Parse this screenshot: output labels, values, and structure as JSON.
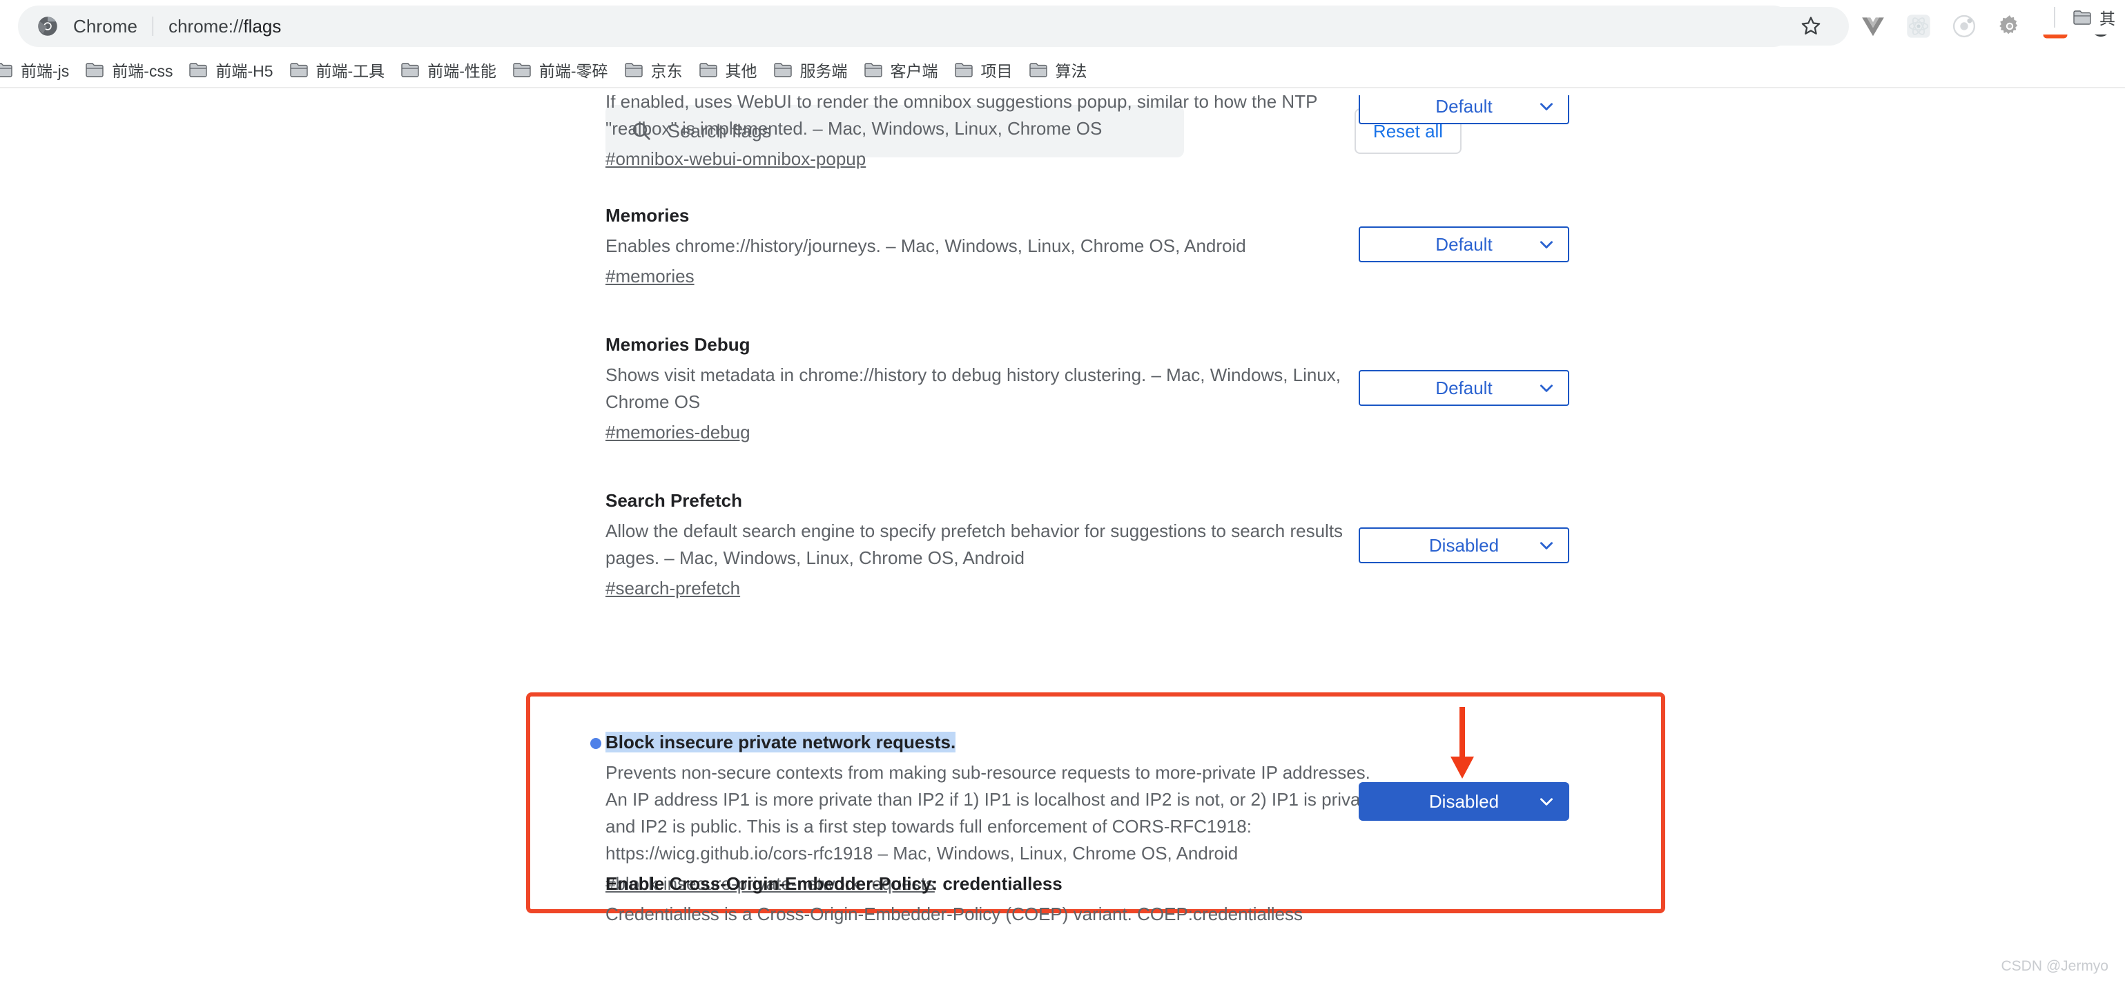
{
  "browser": {
    "omnibox": {
      "app_name": "Chrome",
      "url_prefix": "chrome://",
      "url_suffix": "flags",
      "chrome_logo_icon": "chrome-logo-icon",
      "star_icon": "bookmark-star-icon"
    },
    "extensions": [
      {
        "name": "vue-devtools-icon",
        "color": "#8a8a8a"
      },
      {
        "name": "react-devtools-icon",
        "color": "#d8d8d8"
      },
      {
        "name": "ionic-devtools-icon",
        "color": "#d0d0d0"
      },
      {
        "name": "gear-extension-icon",
        "color": "#9e9e9e"
      },
      {
        "name": "orange-extension-icon",
        "color": "#f4511e"
      },
      {
        "name": "sync-extension-icon",
        "color": "#3c4043"
      },
      {
        "name": "profile-avatar-icon",
        "color": "#9aa0a6"
      }
    ],
    "bookmarks": [
      {
        "label": "前端-js"
      },
      {
        "label": "前端-css"
      },
      {
        "label": "前端-H5"
      },
      {
        "label": "前端-工具"
      },
      {
        "label": "前端-性能"
      },
      {
        "label": "前端-零碎"
      },
      {
        "label": "京东"
      },
      {
        "label": "其他"
      },
      {
        "label": "服务端"
      },
      {
        "label": "客户端"
      },
      {
        "label": "项目"
      },
      {
        "label": "算法"
      }
    ],
    "bookmarks_overflow": {
      "label": "其"
    }
  },
  "search": {
    "placeholder": "Search flags",
    "value": "",
    "icon": "search-icon"
  },
  "toolbar": {
    "reset_all_label": "Reset all"
  },
  "flags": [
    {
      "title": "",
      "description": "If enabled, uses WebUI to render the omnibox suggestions popup, similar to how the NTP \"realbox\" is implemented. – Mac, Windows, Linux, Chrome OS",
      "link": "#omnibox-webui-omnibox-popup",
      "select_value": "Default",
      "highlighted": false,
      "clipped": true
    },
    {
      "title": "Memories",
      "description": "Enables chrome://history/journeys. – Mac, Windows, Linux, Chrome OS, Android",
      "link": "#memories",
      "select_value": "Default",
      "highlighted": false,
      "clipped": false
    },
    {
      "title": "Memories Debug",
      "description": "Shows visit metadata in chrome://history to debug history clustering. – Mac, Windows, Linux, Chrome OS",
      "link": "#memories-debug",
      "select_value": "Default",
      "highlighted": false,
      "clipped": false
    },
    {
      "title": "Search Prefetch",
      "description": "Allow the default search engine to specify prefetch behavior for suggestions to search results pages. – Mac, Windows, Linux, Chrome OS, Android",
      "link": "#search-prefetch",
      "select_value": "Disabled",
      "highlighted": false,
      "clipped": false
    },
    {
      "title": "Block insecure private network requests.",
      "description": "Prevents non-secure contexts from making sub-resource requests to more-private IP addresses. An IP address IP1 is more private than IP2 if 1) IP1 is localhost and IP2 is not, or 2) IP1 is private and IP2 is public. This is a first step towards full enforcement of CORS-RFC1918: https://wicg.github.io/cors-rfc1918 – Mac, Windows, Linux, Chrome OS, Android",
      "link": "#block-insecure-private-network-requests",
      "select_value": "Disabled",
      "highlighted": true,
      "clipped": false
    },
    {
      "title": "Enable Cross-Origin-Embedder-Policy: credentialless",
      "description": "Credentialless is a Cross-Origin-Embedder-Policy (COEP) variant. COEP:credentialless",
      "link": "",
      "select_value": "",
      "highlighted": false,
      "clipped": false
    }
  ],
  "annotation": {
    "box_color": "#ef4627",
    "arrow_color": "#f03c18",
    "arrow_name": "red-pointer-arrow",
    "title_highlight_color": "#bfd8f7",
    "marker_dot_color": "#4f81e8"
  },
  "watermark": {
    "text": "CSDN @Jermyo"
  }
}
